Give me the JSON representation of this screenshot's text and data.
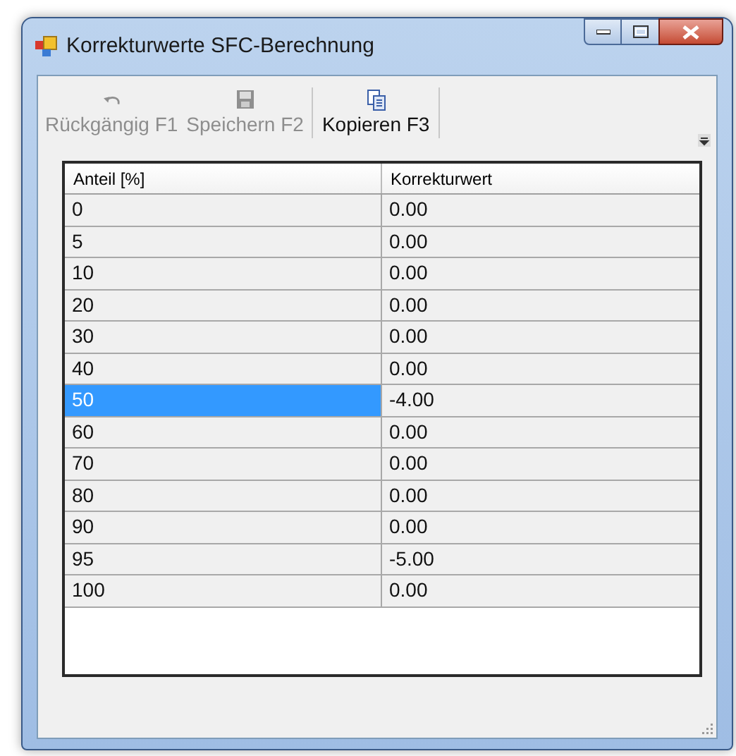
{
  "window": {
    "title": "Korrekturwerte SFC-Berechnung"
  },
  "toolbar": [
    {
      "label": "Rückgängig F1",
      "kind": "undo",
      "disabled": true
    },
    {
      "label": "Speichern F2",
      "kind": "save",
      "disabled": true
    },
    {
      "label": "Kopieren F3",
      "kind": "copy",
      "disabled": false
    }
  ],
  "table": {
    "columns": [
      "Anteil [%]",
      "Korrekturwert"
    ],
    "rows": [
      {
        "cells": [
          "0",
          "0.00"
        ],
        "selected": false
      },
      {
        "cells": [
          "5",
          "0.00"
        ],
        "selected": false
      },
      {
        "cells": [
          "10",
          "0.00"
        ],
        "selected": false
      },
      {
        "cells": [
          "20",
          "0.00"
        ],
        "selected": false
      },
      {
        "cells": [
          "30",
          "0.00"
        ],
        "selected": false
      },
      {
        "cells": [
          "40",
          "0.00"
        ],
        "selected": false
      },
      {
        "cells": [
          "50",
          "-4.00"
        ],
        "selected": true
      },
      {
        "cells": [
          "60",
          "0.00"
        ],
        "selected": false
      },
      {
        "cells": [
          "70",
          "0.00"
        ],
        "selected": false
      },
      {
        "cells": [
          "80",
          "0.00"
        ],
        "selected": false
      },
      {
        "cells": [
          "90",
          "0.00"
        ],
        "selected": false
      },
      {
        "cells": [
          "95",
          "-5.00"
        ],
        "selected": false
      },
      {
        "cells": [
          "100",
          "0.00"
        ],
        "selected": false
      }
    ]
  }
}
